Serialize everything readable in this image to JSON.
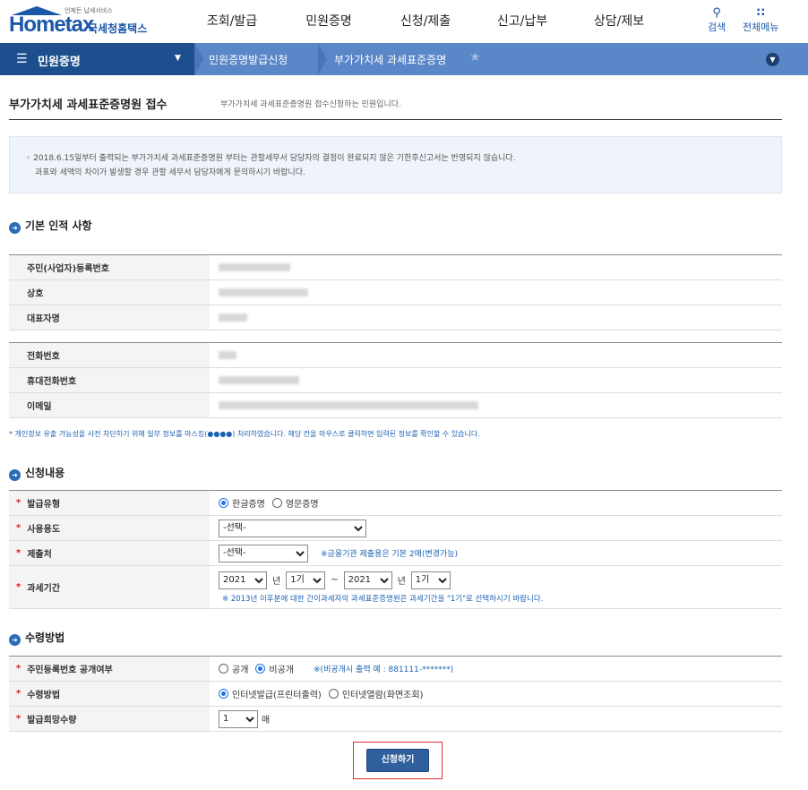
{
  "header": {
    "logo_text": "Hometax",
    "logo_tagline": "언제든 납세서비스",
    "logo_korean": "국세청홈택스",
    "nav": [
      "조회/발급",
      "민원증명",
      "신청/제출",
      "신고/납부",
      "상담/제보"
    ],
    "search_label": "검색",
    "all_menu_label": "전체메뉴"
  },
  "location": {
    "main": "민원증명",
    "crumb1": "민원증명발급신청",
    "crumb2": "부가가치세 과세표준증명"
  },
  "page": {
    "title": "부가가치세 과세표준증명원 접수",
    "subtitle": "부가가치세 과세표준증명원 접수신청하는 민원입니다.",
    "notice_line1": "◦ 2018.6.15일부터 출력되는 부가가치세 과세표준증명원 부터는 관할세무서 담당자의 결정이 완료되지 않은 기한후신고서는 반영되지 않습니다.",
    "notice_line2": "과표와 세액의 차이가 발생할 경우 관할 세무서 담당자에게 문의하시기 바랍니다."
  },
  "basic": {
    "section_title": "기본 인적 사항",
    "labels": {
      "reg_no": "주민(사업자)등록번호",
      "company": "상호",
      "rep": "대표자명",
      "phone": "전화번호",
      "mobile": "휴대전화번호",
      "email": "이메일"
    },
    "privacy_note": "* 개인정보 유출 가능성을 사전 차단하기 위해 일부 정보를 마스킹(●●●●) 처리하였습니다. 해당 칸을 마우스로 클릭하면 입력된 정보를 확인할 수 있습니다."
  },
  "apply": {
    "section_title": "신청내용",
    "issue_type_label": "발급유형",
    "issue_type_options": [
      "한글증명",
      "영문증명"
    ],
    "purpose_label": "사용용도",
    "purpose_value": "-선택-",
    "submit_to_label": "제출처",
    "submit_to_value": "-선택-",
    "submit_to_hint": "※금융기관 제출용은 기본 2매(변경가능)",
    "period_label": "과세기간",
    "from_year": "2021",
    "year_unit": "년",
    "from_term": "1기",
    "tilde": "~",
    "to_year": "2021",
    "to_term": "1기",
    "period_hint": "※ 2013년 이후분에 대한 간이과세자의 과세표준증명원은 과세기간을 \"1기\"로 선택하시기 바랍니다."
  },
  "receive": {
    "section_title": "수령방법",
    "disclose_label": "주민등록번호 공개여부",
    "disclose_options": [
      "공개",
      "비공개"
    ],
    "disclose_hint": "※(비공개시 출력 예 : 881111-*******)",
    "method_label": "수령방법",
    "method_options": [
      "인터넷발급(프린터출력)",
      "인터넷열람(화면조회)"
    ],
    "qty_label": "발급희망수량",
    "qty_value": "1",
    "qty_unit": "매"
  },
  "submit_label": "신청하기",
  "colors": {
    "primary": "#1d4f8f",
    "accent": "#5a87c8",
    "required": "#d41e1e",
    "highlight": "#e02a2a"
  }
}
